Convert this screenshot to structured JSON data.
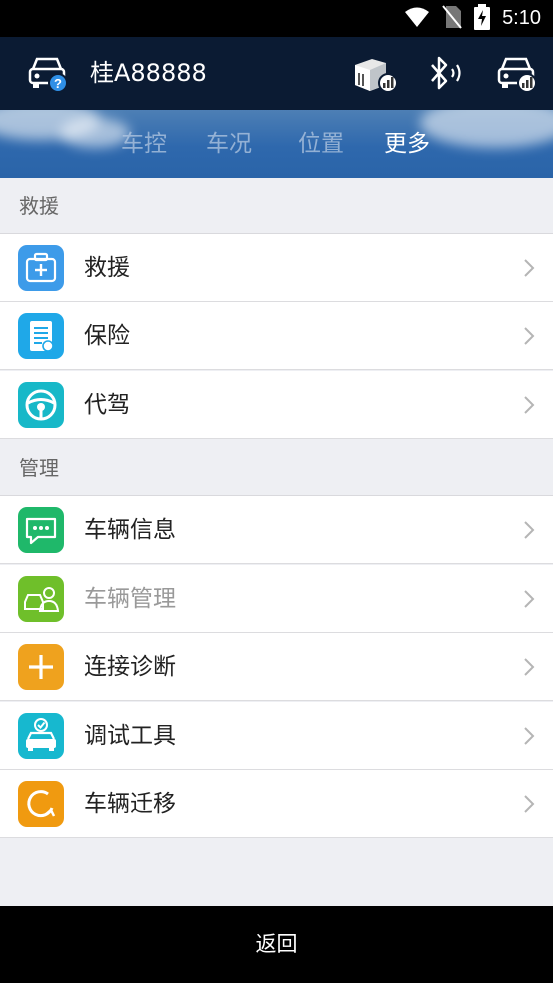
{
  "status_bar": {
    "time": "5:10"
  },
  "header": {
    "plate": "桂A88888"
  },
  "tabs": [
    {
      "label": "车控"
    },
    {
      "label": "车况"
    },
    {
      "label": "位置"
    },
    {
      "label": "更多"
    }
  ],
  "active_tab": "更多",
  "sections": [
    {
      "title": "救援",
      "items": [
        {
          "label": "救援",
          "icon": "first-aid-kit-icon",
          "color": "#3d9be9"
        },
        {
          "label": "保险",
          "icon": "insurance-document-icon",
          "color": "#1fa8e8"
        },
        {
          "label": "代驾",
          "icon": "steering-wheel-icon",
          "color": "#17b8c8"
        }
      ]
    },
    {
      "title": "管理",
      "items": [
        {
          "label": "车辆信息",
          "icon": "chat-bubbles-icon",
          "color": "#1fb86a"
        },
        {
          "label": "车辆管理",
          "icon": "car-person-icon",
          "color": "#6fbf2a",
          "disabled": true
        },
        {
          "label": "连接诊断",
          "icon": "plus-icon",
          "color": "#efa21e"
        },
        {
          "label": "调试工具",
          "icon": "car-check-icon",
          "color": "#17b8cf"
        },
        {
          "label": "车辆迁移",
          "icon": "refresh-icon",
          "color": "#f09a10"
        }
      ]
    }
  ],
  "bottom": {
    "back_label": "返回"
  }
}
